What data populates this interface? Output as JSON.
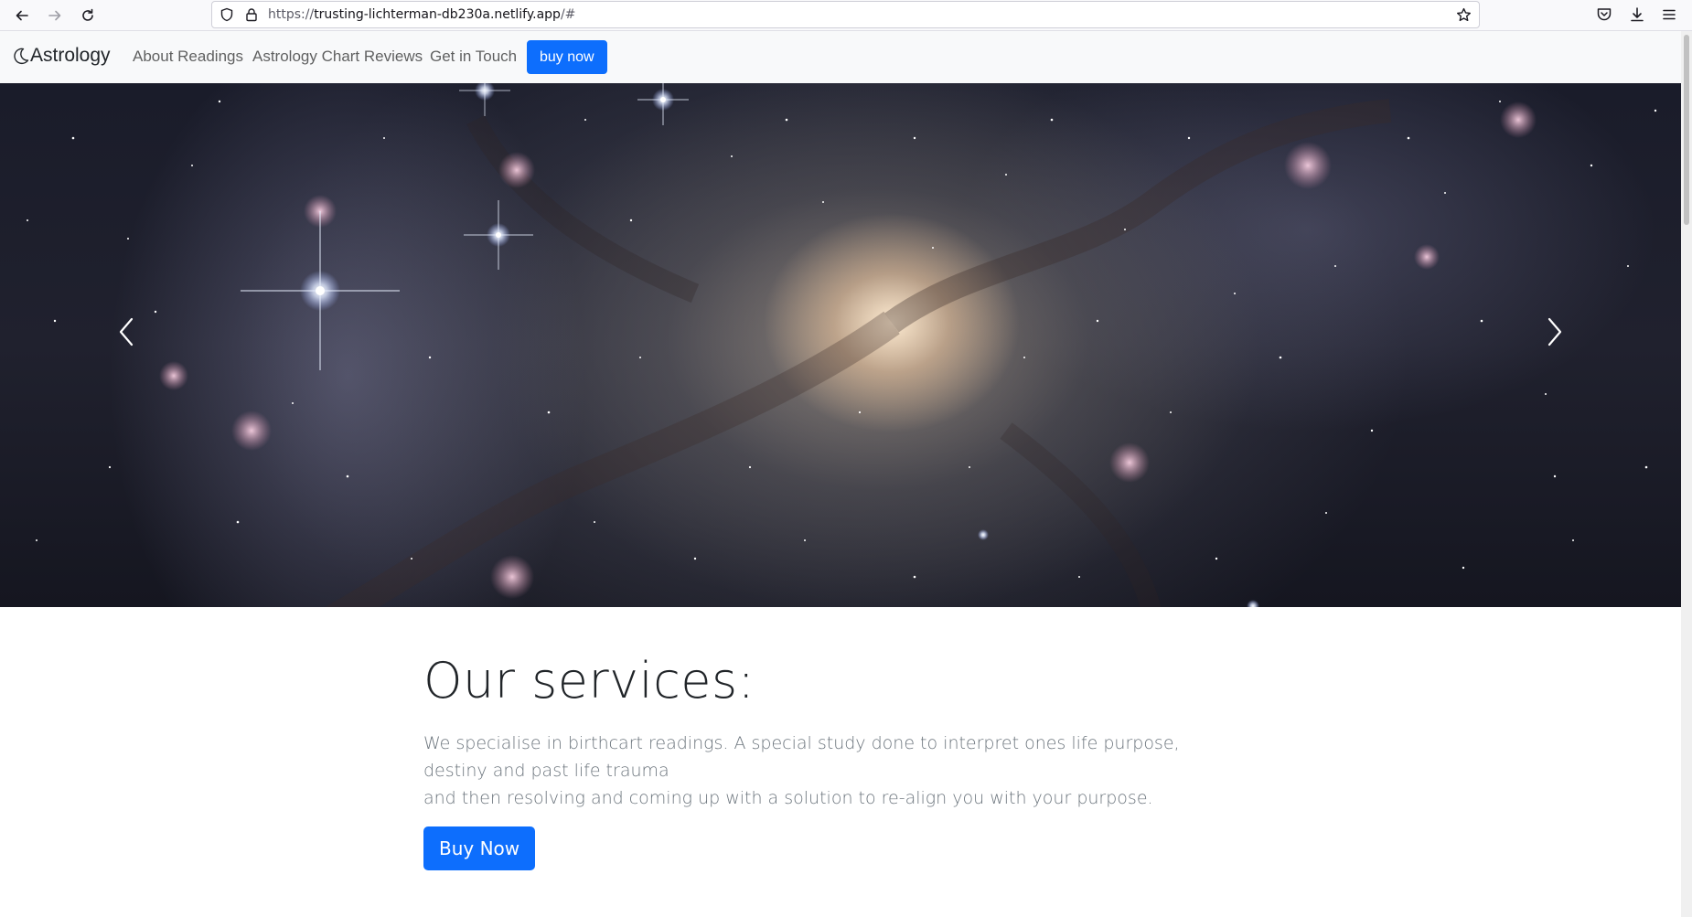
{
  "browser": {
    "url_scheme": "https://",
    "url_host": "trusting-lichterman-db230a.netlify.app",
    "url_path": "/#",
    "icons": [
      "back-arrow-icon",
      "forward-arrow-icon",
      "reload-icon",
      "shield-icon",
      "lock-icon",
      "bookmark-star-icon",
      "pocket-icon",
      "downloads-icon",
      "hamburger-menu-icon"
    ]
  },
  "navbar": {
    "brand": "Astrology",
    "brand_icon": "crescent-moon-icon",
    "links": [
      "About Readings",
      "Astrology Chart Reviews",
      "Get in Touch"
    ],
    "buy_label": "buy now",
    "accent": "#0d6efd"
  },
  "carousel": {
    "prev_icon": "chevron-left-icon",
    "next_icon": "chevron-right-icon"
  },
  "services": {
    "title": "Our services:",
    "description_line1": "We specialise in birthcart readings. A special study done to interpret ones life purpose, destiny and past life trauma",
    "description_line2": "and then resolving and coming up with a solution to re-align you with your purpose.",
    "button_label": "Buy Now"
  }
}
